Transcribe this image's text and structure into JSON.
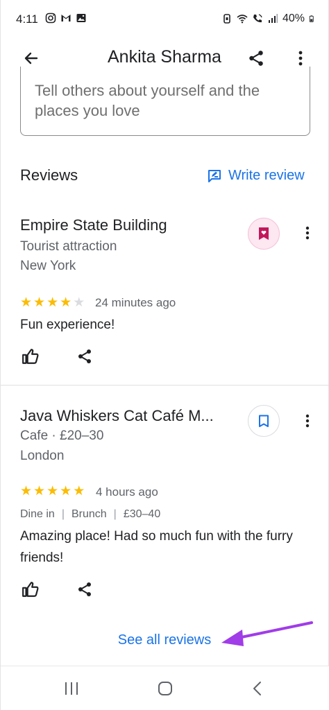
{
  "status_bar": {
    "time": "4:11",
    "battery": "40%",
    "left_icons": [
      "instagram-icon",
      "gmail-icon",
      "gallery-icon"
    ],
    "right_icons": [
      "alarm-icon",
      "wifi-icon",
      "wifi-calling-icon",
      "signal-icon"
    ]
  },
  "header": {
    "title": "Ankita Sharma"
  },
  "bio": {
    "placeholder": "Tell others about yourself and the places you love"
  },
  "reviews": {
    "heading": "Reviews",
    "write_review_label": "Write review",
    "items": [
      {
        "place": "Empire State Building",
        "category": "Tourist attraction",
        "location": "New York",
        "rating": 4,
        "max_rating": 5,
        "time_ago": "24 minutes ago",
        "text": "Fun experience!",
        "saved": true
      },
      {
        "place": "Java Whiskers Cat Café M...",
        "category": "Cafe · £20–30",
        "location": "London",
        "rating": 5,
        "max_rating": 5,
        "time_ago": "4 hours ago",
        "tags": [
          "Dine in",
          "Brunch",
          "£30–40"
        ],
        "text": "Amazing place! Had so much fun with the furry friends!",
        "saved": false
      }
    ],
    "see_all_label": "See all reviews"
  },
  "colors": {
    "accent": "#1a73e8",
    "star": "#fbbc04",
    "saved_bg": "#fde7f1",
    "saved_icon": "#c2185b",
    "annotation_arrow": "#a03ce8"
  }
}
